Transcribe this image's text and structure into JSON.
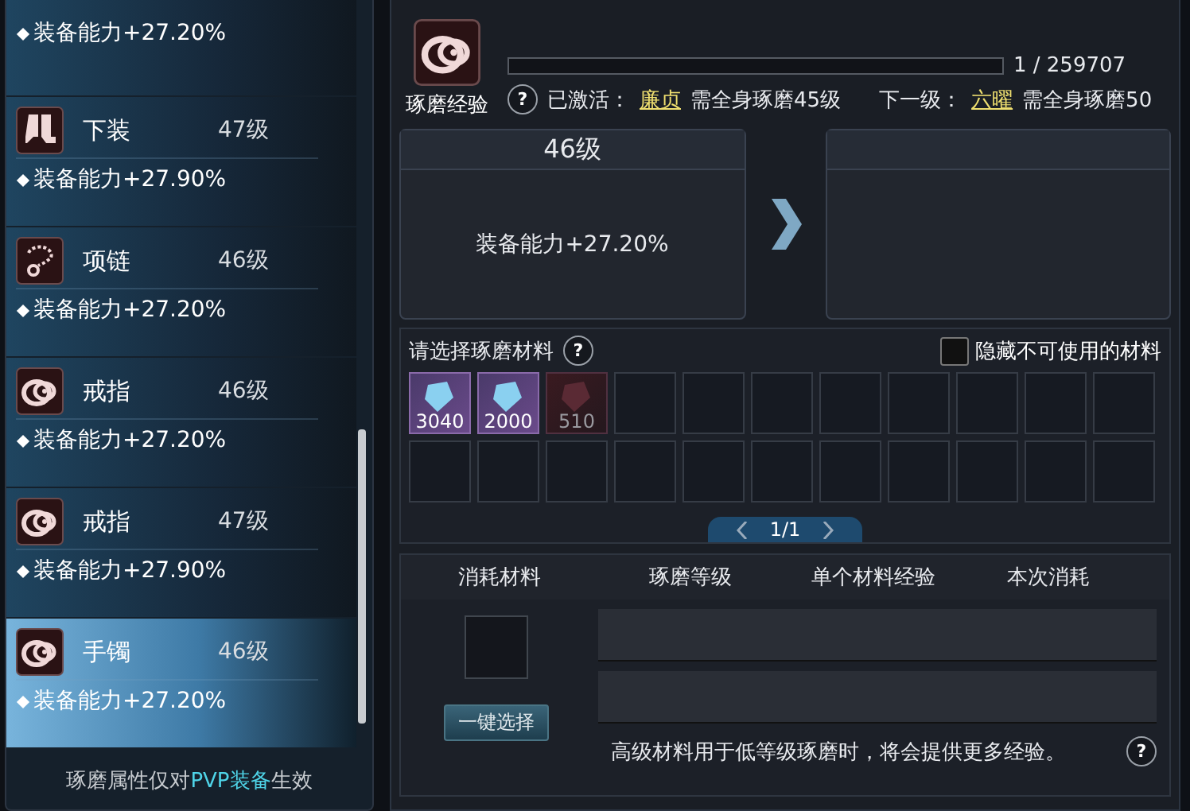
{
  "equipment_list": {
    "items": [
      {
        "kind": "partial",
        "stat": "装备能力+27.20%",
        "selected": false
      },
      {
        "kind": "pants",
        "name": "下装",
        "level": "47级",
        "stat": "装备能力+27.90%",
        "selected": false
      },
      {
        "kind": "necklace",
        "name": "项链",
        "level": "46级",
        "stat": "装备能力+27.20%",
        "selected": false
      },
      {
        "kind": "ring",
        "name": "戒指",
        "level": "46级",
        "stat": "装备能力+27.20%",
        "selected": false
      },
      {
        "kind": "ring",
        "name": "戒指",
        "level": "47级",
        "stat": "装备能力+27.90%",
        "selected": false
      },
      {
        "kind": "bracelet",
        "name": "手镯",
        "level": "46级",
        "stat": "装备能力+27.20%",
        "selected": true
      }
    ],
    "footer_before": "琢磨属性仅对",
    "footer_highlight": "PVP装备",
    "footer_after": "生效"
  },
  "experience": {
    "help": "?",
    "label": "琢磨经验",
    "level": 0.0,
    "progress_text": "1 / 259707",
    "active_label": "已激活：",
    "active_name": "廉贞",
    "active_req": "需全身琢磨45级",
    "next_label": "下一级：",
    "next_name": "六曜",
    "next_req": "需全身琢磨50"
  },
  "current": {
    "title": "46级",
    "stat": "装备能力+27.20%"
  },
  "materials": {
    "help": "?",
    "title": "请选择琢磨材料",
    "hide_unusable": {
      "label": "隐藏不可使用的材料",
      "checked": false
    },
    "slots": [
      {
        "count": "3040",
        "disabled": false
      },
      {
        "count": "2000",
        "disabled": false
      },
      {
        "count": "510",
        "disabled": true
      }
    ],
    "page": "1/1"
  },
  "consume": {
    "columns": [
      "消耗材料",
      "琢磨等级",
      "单个材料经验",
      "本次消耗"
    ],
    "button": "一键选择",
    "hint": "高级材料用于低等级琢磨时，将会提供更多经验。",
    "help": "?"
  }
}
